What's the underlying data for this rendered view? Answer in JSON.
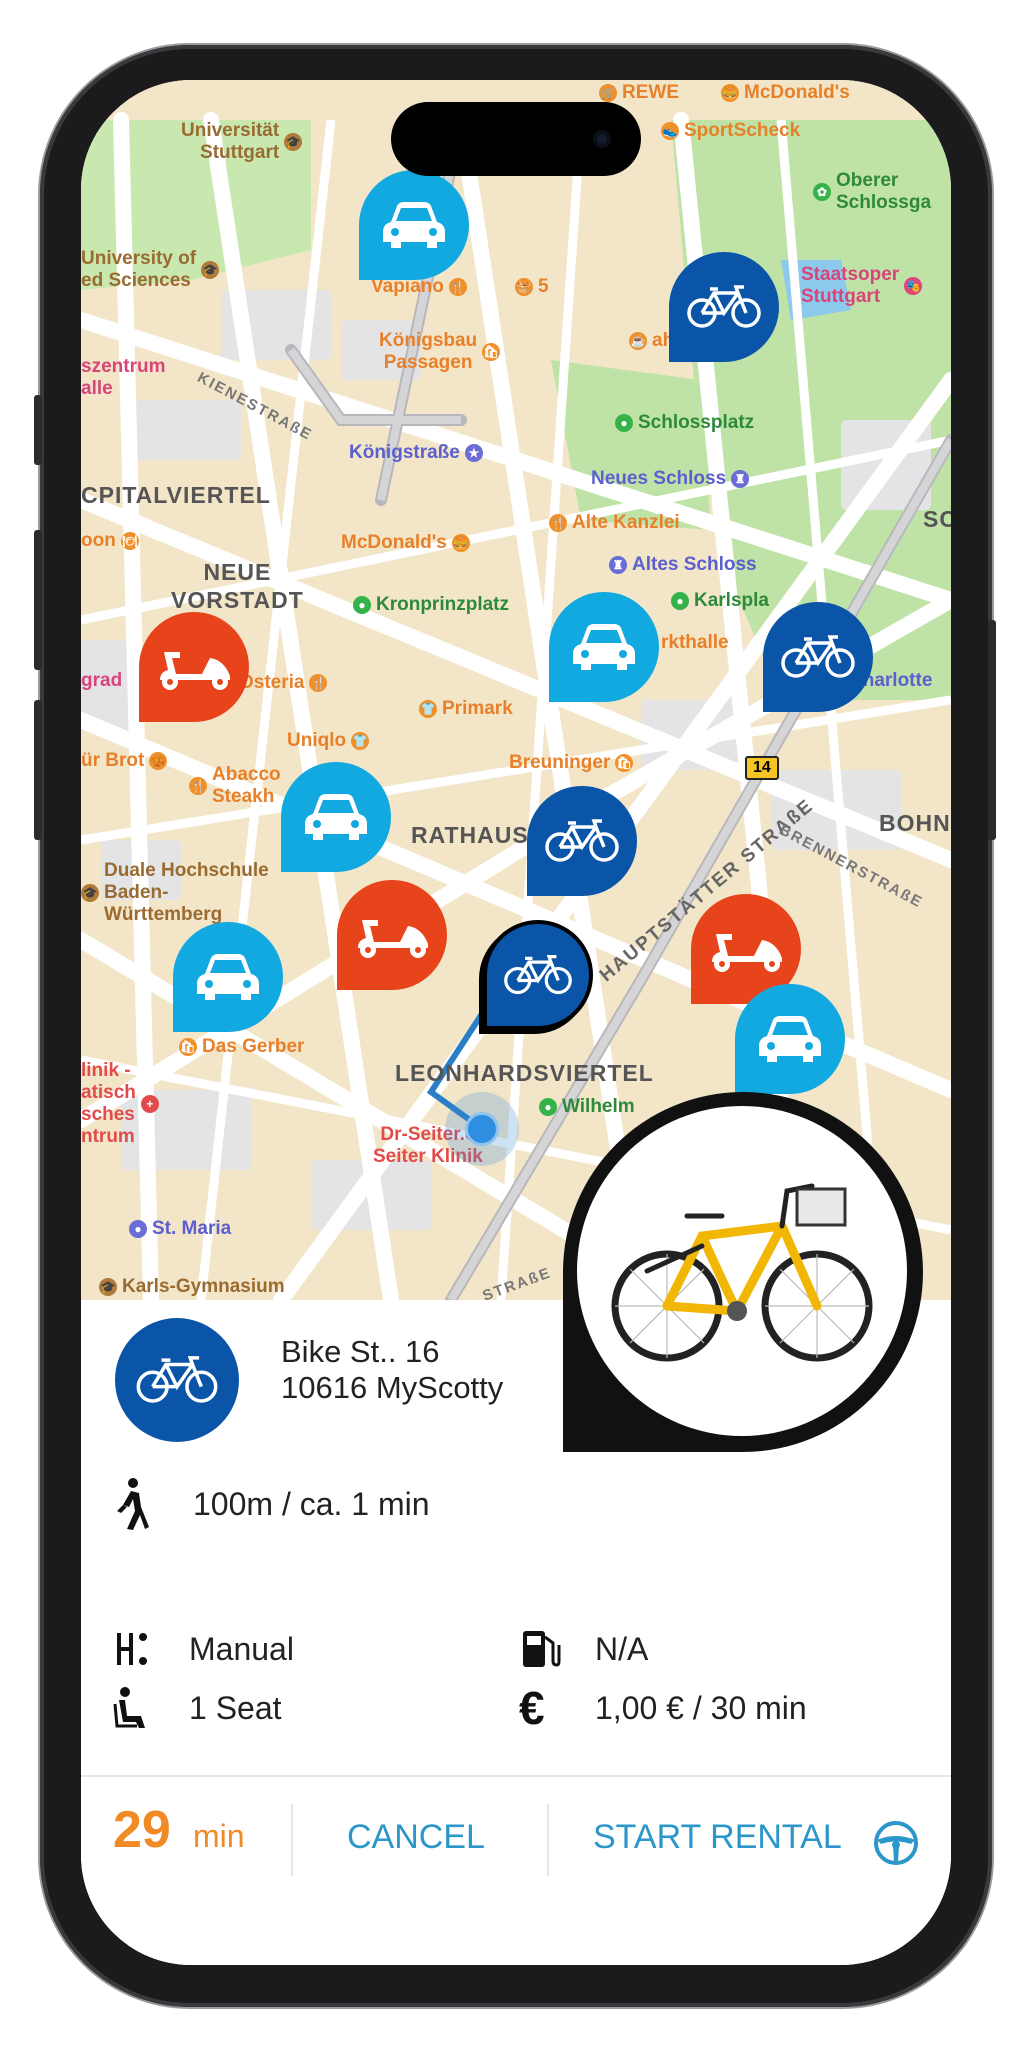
{
  "map": {
    "pois": [
      {
        "label": "Universität\nStuttgart",
        "color": "brown"
      },
      {
        "label": "REWE",
        "color": "orange"
      },
      {
        "label": "McDonald's",
        "color": "orange"
      },
      {
        "label": "SportScheck",
        "color": "orange"
      },
      {
        "label": "Oberer\nSchlossga",
        "color": "green"
      },
      {
        "label": "University of\ned Sciences",
        "color": "brown"
      },
      {
        "label": "Vapiano",
        "color": "orange"
      },
      {
        "label": "5",
        "color": "orange"
      },
      {
        "label": "Staatsoper\nStuttgart",
        "color": "pink"
      },
      {
        "label": "Königsbau\nPassagen",
        "color": "orange"
      },
      {
        "label": "ahaus",
        "color": "orange"
      },
      {
        "label": "Schlossplatz",
        "color": "green"
      },
      {
        "label": "Königstraße",
        "color": "purple"
      },
      {
        "label": "Neues Schloss",
        "color": "purple"
      },
      {
        "label": "McDonald's",
        "color": "orange"
      },
      {
        "label": "Alte Kanzlei",
        "color": "orange"
      },
      {
        "label": "Altes Schloss",
        "color": "purple"
      },
      {
        "label": "Kronprinzplatz",
        "color": "green"
      },
      {
        "label": "Karlspla",
        "color": "green"
      },
      {
        "label": "rkthalle",
        "color": "orange"
      },
      {
        "label": "Charlotte",
        "color": "purple"
      },
      {
        "label": "Osteria",
        "color": "orange"
      },
      {
        "label": "Primark",
        "color": "orange"
      },
      {
        "label": "Uniqlo",
        "color": "orange"
      },
      {
        "label": "Breuninger",
        "color": "orange"
      },
      {
        "label": "ür Brot",
        "color": "orange"
      },
      {
        "label": "Abacco\nSteakh",
        "color": "orange"
      },
      {
        "label": "Duale Hochschule\nBaden-\nWürttemberg",
        "color": "brown"
      },
      {
        "label": "Das Gerber",
        "color": "orange"
      },
      {
        "label": "Wilhelm",
        "color": "green"
      },
      {
        "label": "Dr-Seiter.c\nSeiter Klinik",
        "color": "red"
      },
      {
        "label": "St. Maria",
        "color": "purple"
      },
      {
        "label": "Karls-Gymnasium",
        "color": "brown"
      },
      {
        "label": "linik -\natisch\nsches\nntrum",
        "color": "red"
      },
      {
        "label": "oon",
        "color": "orange"
      },
      {
        "label": "grad",
        "color": "pink"
      },
      {
        "label": "szentrum\nalle",
        "color": "pink"
      }
    ],
    "districts": [
      "CPITALVIERTEL",
      "NEUE\nVORSTADT",
      "RATHAUS",
      "LEONHARDSVIERTEL",
      "BOHN",
      "SC"
    ],
    "streets": [
      "KIENESTRAßE",
      "HAUPTSTÄTTER STRAßE",
      "BRENNERSTRAßE",
      "STRAßE"
    ],
    "route_badge": "14",
    "marker_icons": {
      "car": "car-icon",
      "bike": "bicycle-icon",
      "scooter": "scooter-icon"
    }
  },
  "detail": {
    "address_line1": "Bike St.. 16",
    "address_line2": "10616 MyScotty",
    "walk": "100m / ca. 1 min",
    "transmission": "Manual",
    "fuel": "N/A",
    "seats": "1 Seat",
    "price": "1,00 € / 30 min",
    "vehicle_icon": "bicycle-icon",
    "photo": "yellow-city-bike"
  },
  "footer": {
    "timer_value": "29",
    "timer_unit": "min",
    "cancel_label": "CANCEL",
    "start_label": "START RENTAL",
    "start_icon": "steering-wheel-icon"
  },
  "colors": {
    "car": "#12a8e0",
    "bike": "#0a55a8",
    "scooter": "#e8441c",
    "accent_orange": "#f08a24",
    "action_blue": "#2a96c9"
  }
}
